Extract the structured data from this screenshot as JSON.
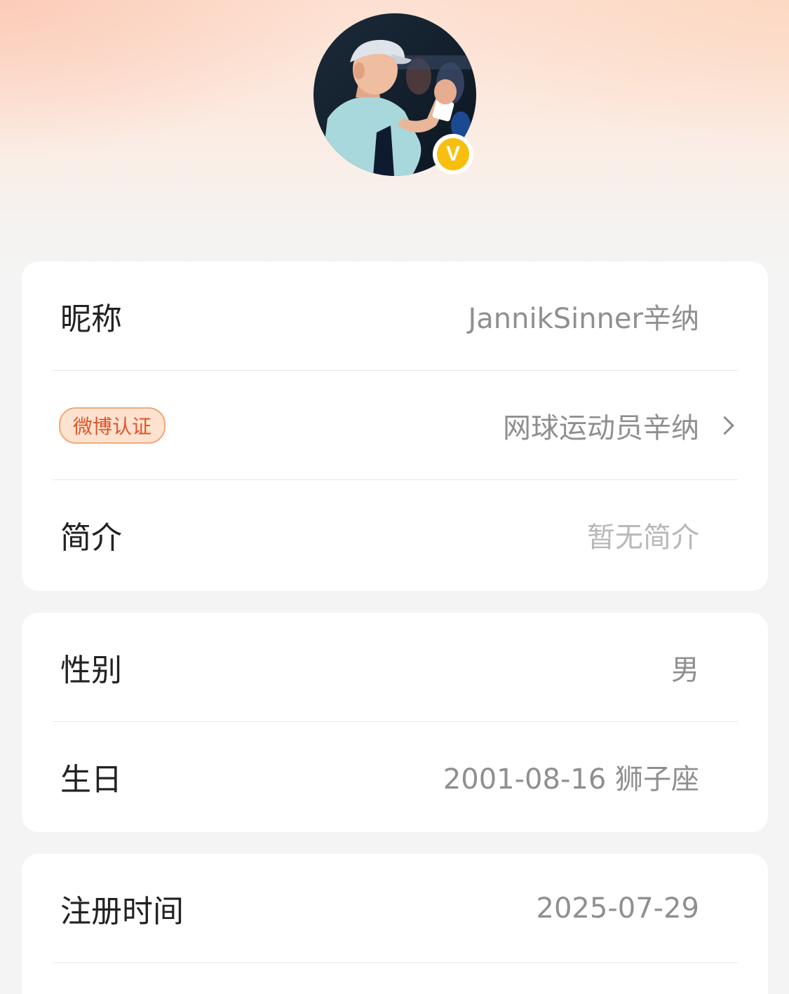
{
  "profile": {
    "avatar_alt": "avatar",
    "verified_mark": "V"
  },
  "basic_info": {
    "nickname_label": "昵称",
    "nickname_value": "JannikSinner辛纳",
    "verification_badge": "微博认证",
    "verification_value": "网球运动员辛纳",
    "bio_label": "简介",
    "bio_value": "暂无简介"
  },
  "personal_info": {
    "gender_label": "性别",
    "gender_value": "男",
    "birthday_label": "生日",
    "birthday_value": "2001-08-16 狮子座"
  },
  "account_info": {
    "register_label": "注册时间",
    "register_value": "2025-07-29"
  },
  "colors": {
    "badge_text": "#e2532b",
    "badge_bg": "#fde3cf",
    "verified_gold": "#f9bf10"
  }
}
